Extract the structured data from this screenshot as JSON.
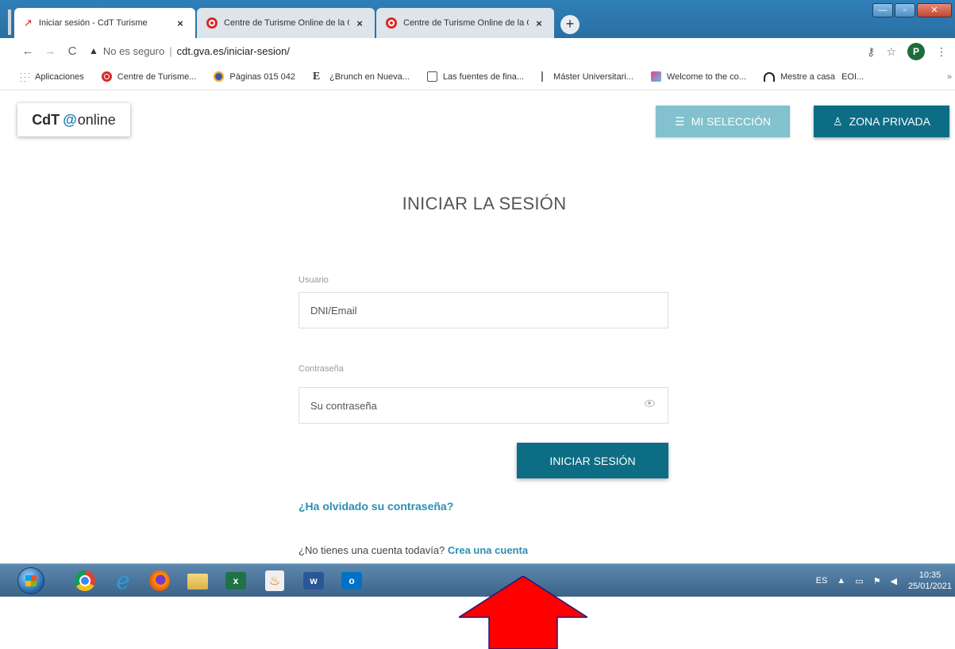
{
  "browser": {
    "tabs": [
      {
        "label": "Iniciar sesión - CdT Turisme",
        "active": true
      },
      {
        "label": "Centre de Turisme Online de la G",
        "active": false
      },
      {
        "label": "Centre de Turisme Online de la G",
        "active": false
      }
    ],
    "tab_close_glyph": "×",
    "new_tab_glyph": "+",
    "insecure_label": "No es seguro",
    "url": "cdt.gva.es/iniciar-sesion/",
    "profile_initial": "P",
    "bookmarks": [
      {
        "label": "Aplicaciones",
        "icon": "apps-icon"
      },
      {
        "label": "Centre de Turisme...",
        "icon": "cdt-favicon-icon"
      },
      {
        "label": "Páginas 015 042",
        "icon": "globe-favicon-icon"
      },
      {
        "label": "¿Brunch en Nueva...",
        "icon": "e-favicon-icon"
      },
      {
        "label": "Las fuentes de fina...",
        "icon": "document-favicon-icon"
      },
      {
        "label": "Máster Universitari...",
        "icon": "fork-favicon-icon"
      },
      {
        "label": "Welcome to the co...",
        "icon": "pink-favicon-icon"
      },
      {
        "label": "Mestre a casa",
        "icon": "house-favicon-icon"
      },
      {
        "label": "EOI...",
        "icon": ""
      }
    ]
  },
  "site": {
    "logo": {
      "cdt": "CdT",
      "at": "@",
      "online": "online"
    },
    "header_buttons": {
      "selection_label": "MI SELECCIÓN",
      "private_zone_label": "ZONA PRIVADA"
    },
    "title": "INICIAR LA SESIÓN",
    "user_field": {
      "label": "Usuario",
      "placeholder": "DNI/Email",
      "value": ""
    },
    "password_field": {
      "label": "Contraseña",
      "placeholder": "Su contraseña",
      "value": ""
    },
    "login_button_label": "INICIAR SESIÓN",
    "forgot_password_link": "¿Ha olvidado su contraseña?",
    "no_account_text": "¿No tienes una cuenta todavía? ",
    "create_account_link": "Crea una cuenta",
    "accent_color": "#0d6d85",
    "link_color": "#2d8fb0",
    "selection_button_color": "#82c1cd"
  },
  "taskbar": {
    "apps": [
      "start",
      "chrome",
      "internet-explorer",
      "firefox",
      "file-explorer",
      "excel",
      "java",
      "word",
      "outlook"
    ],
    "language": "ES",
    "time": "10:35",
    "date": "25/01/2021"
  },
  "annotation": {
    "arrow_color": "#ff0000",
    "arrow_direction": "up"
  }
}
